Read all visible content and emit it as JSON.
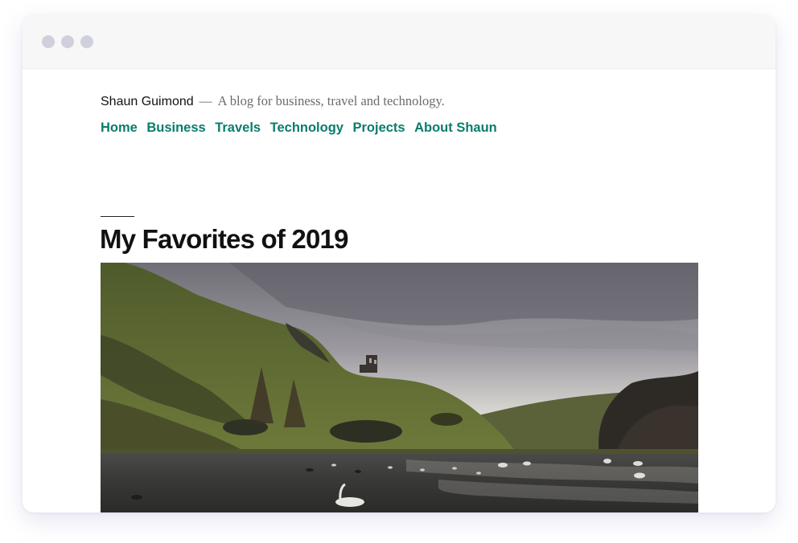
{
  "window": {
    "controls": [
      "window-dot",
      "window-dot",
      "window-dot"
    ]
  },
  "site": {
    "title": "Shaun Guimond",
    "separator": "—",
    "description": "A blog for business, travel and technology."
  },
  "nav": {
    "items": [
      {
        "label": "Home"
      },
      {
        "label": "Business"
      },
      {
        "label": "Travels"
      },
      {
        "label": "Technology"
      },
      {
        "label": "Projects"
      },
      {
        "label": "About Shaun"
      }
    ]
  },
  "post": {
    "title": "My Favorites of 2019"
  },
  "colors": {
    "link": "#0a7c6b",
    "text": "#111111",
    "muted": "#6b6b6b"
  }
}
